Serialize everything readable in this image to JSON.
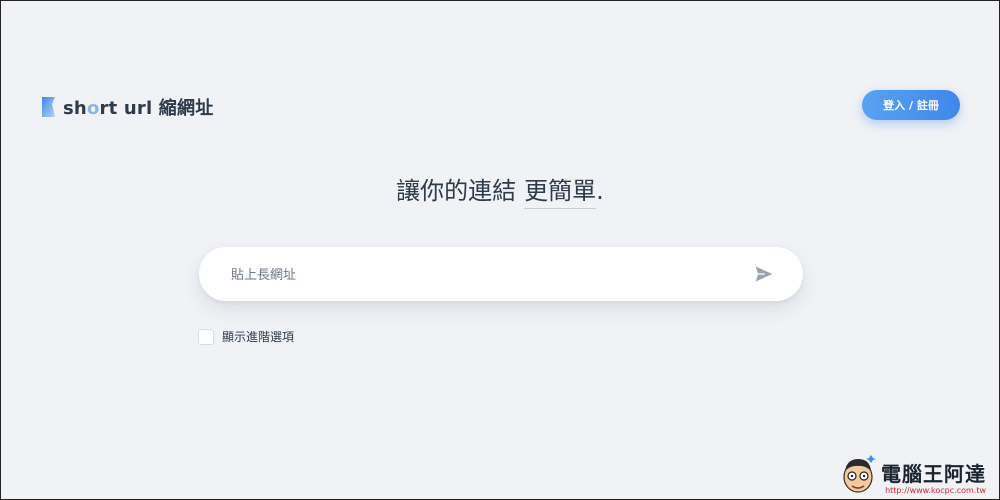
{
  "logo": {
    "text_prefix": "sh",
    "text_mid": "o",
    "text_rest": "rt url 縮網址"
  },
  "header": {
    "login_label": "登入 / 註冊"
  },
  "headline": {
    "main": "讓你的連結",
    "accent": "更簡單",
    "suffix": "."
  },
  "url_form": {
    "placeholder": "貼上長網址",
    "value": ""
  },
  "advanced": {
    "label": "顯示進階選項",
    "checked": false
  },
  "icons": {
    "logo": "bookmark-logo-icon",
    "send": "send-icon",
    "checkbox": "checkbox-icon"
  },
  "colors": {
    "accent": "#4a90ec",
    "background": "#f0f2f5",
    "text": "#2f3b4a"
  },
  "watermark": {
    "title": "電腦王阿達",
    "url": "http://www.kocpc.com.tw"
  }
}
